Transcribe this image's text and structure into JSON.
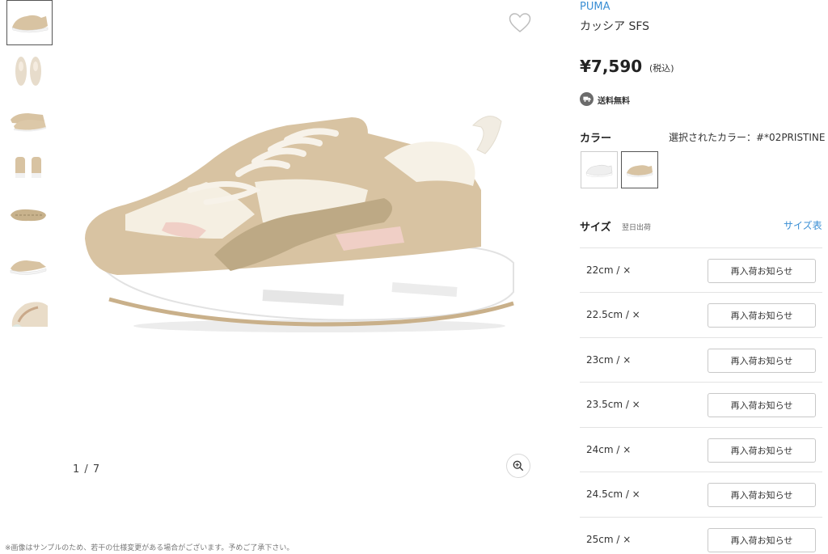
{
  "gallery": {
    "counter": "1 / 7",
    "footnote": "※画像はサンプルのため、若干の仕様変更がある場合がございます。予めご了承下さい。",
    "thumbnails": [
      "thumb-side",
      "thumb-top",
      "thumb-pair-side",
      "thumb-back",
      "thumb-sole",
      "thumb-pair-angle",
      "thumb-detail"
    ]
  },
  "product": {
    "brand": "PUMA",
    "name": "カッシア SFS",
    "price": "¥7,590",
    "tax_note": "(税込)",
    "shipping": "送料無料"
  },
  "color": {
    "title": "カラー",
    "selected_text": "選択されたカラー：#*02PRISTINE"
  },
  "size": {
    "title": "サイズ",
    "subtitle": "翌日出荷",
    "chart_link": "サイズ表",
    "rows": [
      {
        "label": "22cm / ×",
        "button": "再入荷お知らせ"
      },
      {
        "label": "22.5cm / ×",
        "button": "再入荷お知らせ"
      },
      {
        "label": "23cm / ×",
        "button": "再入荷お知らせ"
      },
      {
        "label": "23.5cm / ×",
        "button": "再入荷お知らせ"
      },
      {
        "label": "24cm / ×",
        "button": "再入荷お知らせ"
      },
      {
        "label": "24.5cm / ×",
        "button": "再入荷お知らせ"
      },
      {
        "label": "25cm / ×",
        "button": "再入荷お知らせ"
      }
    ]
  },
  "colors": {
    "brand_link": "#3b8fd4",
    "suede": "#d8c3a2",
    "sole": "#ffffff"
  }
}
